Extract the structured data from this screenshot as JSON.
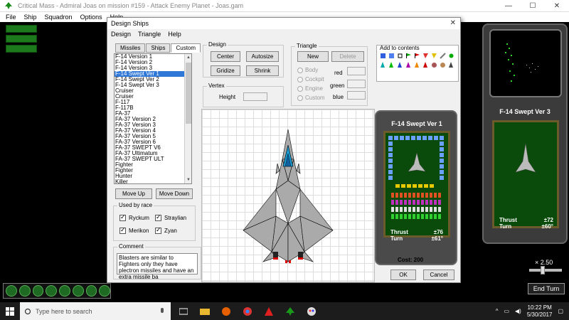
{
  "app": {
    "title": "Critical Mass - Admiral Joas on mission #159 - Attack Enemy Planet - Joas.gam",
    "menu": [
      "File",
      "Ship",
      "Squadron",
      "Options",
      "Help"
    ],
    "controls": {
      "minimize": "—",
      "maximize": "☐",
      "close": "✕"
    }
  },
  "dialog": {
    "title": "Design Ships",
    "close": "✕",
    "menu": [
      "Design",
      "Triangle",
      "Help"
    ],
    "tabs": [
      "Missiles",
      "Ships",
      "Custom"
    ],
    "ship_list": [
      "F-14 Version 1",
      "F-14 Version 2",
      "F-14 Version 3",
      "F-14 Swept Ver 1",
      "F-14 Swept Ver 2",
      "F-14 Swept Ver 3",
      "Cruiser",
      "Cruiser",
      "F-117",
      "F-117B",
      "FA-37",
      "FA-37 Version 2",
      "FA-37 Version 3",
      "FA-37 Version 4",
      "FA-37 Version 5",
      "FA-37 Version 6",
      "FA-37 SWEPT V6",
      "FA-37 Ultimatum",
      "FA-37 SWEPT ULT",
      "Fighter",
      "Fighter",
      "Hunter",
      "Killer"
    ],
    "selected_ship": "F-14 Swept Ver 1",
    "move_up": "Move Up",
    "move_down": "Move Down",
    "used_by_race": {
      "label": "Used by race",
      "races": [
        "Ryckum",
        "Straylian",
        "Merikon",
        "Zyan"
      ]
    },
    "comment": {
      "label": "Comment",
      "text": "Blasters are similar to Fighters only they have plectron missiles and have an extra missile ba"
    },
    "design": {
      "label": "Design",
      "center": "Center",
      "autosize": "Autosize",
      "gridize": "Gridize",
      "shrink": "Shrink"
    },
    "vertex": {
      "label": "Vertex",
      "height": "Height"
    },
    "triangle": {
      "label": "Triangle",
      "new": "New",
      "delete": "Delete",
      "options": [
        "Body",
        "Cockpit",
        "Engine",
        "Custom"
      ],
      "colors": [
        "red",
        "green",
        "blue"
      ]
    },
    "add_to_contents": "Add to contents",
    "card": {
      "name": "F-14 Swept Ver 1",
      "thrust_label": "Thrust",
      "thrust_value": "±76",
      "turn_label": "Turn",
      "turn_value": "±61°"
    },
    "cost": "Cost: 200",
    "ok": "OK",
    "cancel": "Cancel"
  },
  "preview_panel": {
    "name": "F-14 Swept Ver 3",
    "thrust_label": "Thrust",
    "thrust_value": "±72",
    "turn_label": "Turn",
    "turn_value": "±60°"
  },
  "zoom": "× 2.50",
  "end_turn": "End Turn",
  "taskbar": {
    "search_placeholder": "Type here to search",
    "time": "10:22 PM",
    "date": "5/30/2017"
  }
}
